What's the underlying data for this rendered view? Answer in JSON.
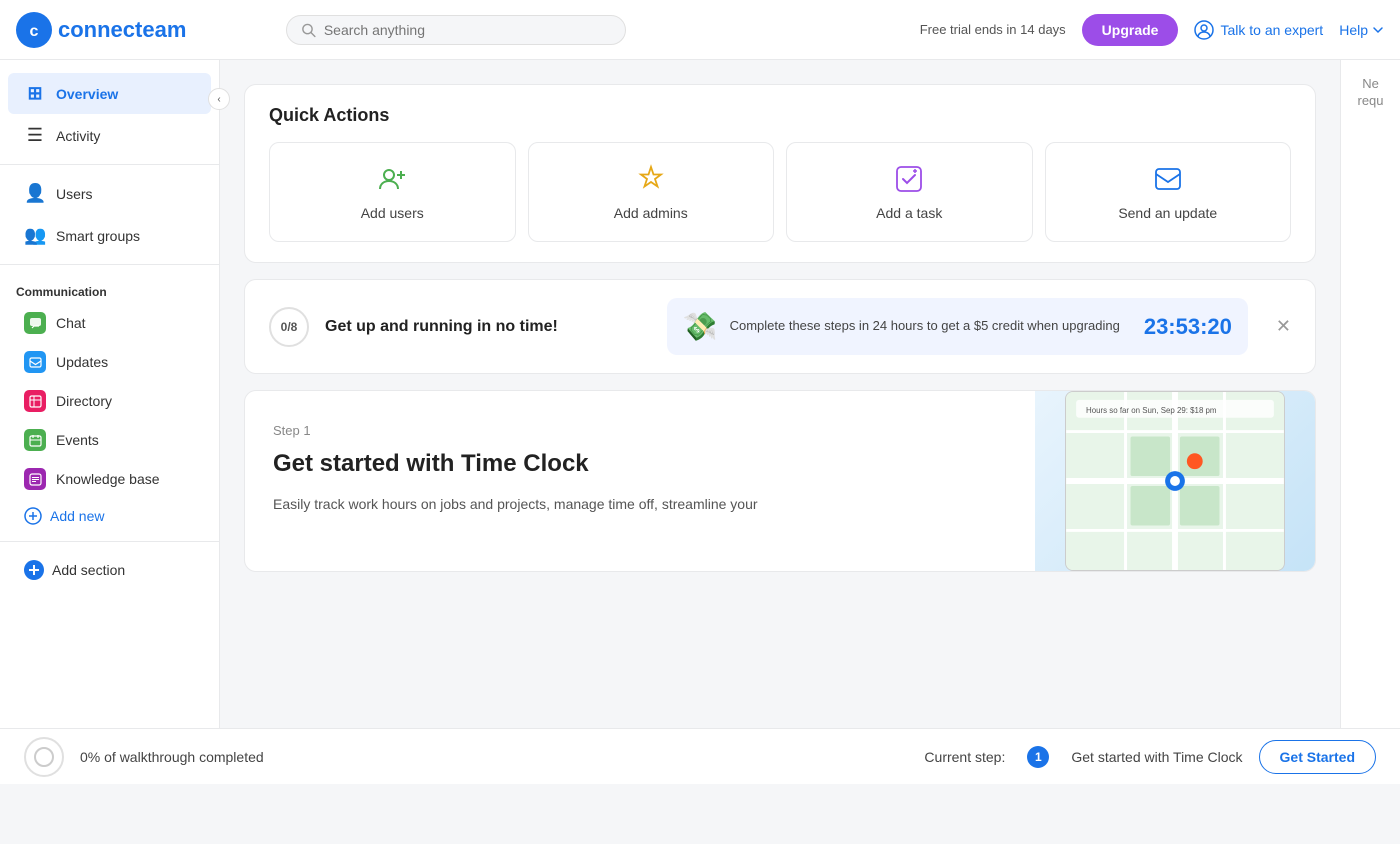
{
  "header": {
    "logo_text": "connecteam",
    "search_placeholder": "Search anything",
    "trial_text": "Free trial ends in 14 days",
    "upgrade_label": "Upgrade",
    "talk_expert_label": "Talk to an expert",
    "help_label": "Help"
  },
  "sidebar": {
    "overview_label": "Overview",
    "activity_label": "Activity",
    "users_label": "Users",
    "smart_groups_label": "Smart groups",
    "communication_label": "Communication",
    "items": [
      {
        "id": "chat",
        "label": "Chat",
        "color": "chat"
      },
      {
        "id": "updates",
        "label": "Updates",
        "color": "updates"
      },
      {
        "id": "directory",
        "label": "Directory",
        "color": "directory"
      },
      {
        "id": "events",
        "label": "Events",
        "color": "events"
      },
      {
        "id": "knowledge",
        "label": "Knowledge base",
        "color": "knowledge"
      }
    ],
    "add_new_label": "Add new",
    "add_section_label": "Add section"
  },
  "quick_actions": {
    "title": "Quick Actions",
    "items": [
      {
        "id": "add-users",
        "label": "Add users",
        "icon": "👤"
      },
      {
        "id": "add-admins",
        "label": "Add admins",
        "icon": "👑"
      },
      {
        "id": "add-task",
        "label": "Add a task",
        "icon": "✅"
      },
      {
        "id": "send-update",
        "label": "Send an update",
        "icon": "✉️"
      }
    ]
  },
  "progress_banner": {
    "fraction": "0/8",
    "text": "Get up and running in no time!",
    "credit_text": "Complete these steps in 24 hours to get a $5 credit when upgrading",
    "timer": "23:53:20"
  },
  "step": {
    "label": "Step 1",
    "title": "Get started with Time Clock",
    "description": "Easily track work hours on jobs and projects, manage time off, streamline your"
  },
  "bottom_bar": {
    "progress_text": "0% of walkthrough completed",
    "current_step_label": "Current step:",
    "step_number": "1",
    "step_text": "Get started with Time Clock",
    "get_started_label": "Get Started"
  },
  "partial_right": {
    "text1": "Ne",
    "text2": "requ"
  }
}
